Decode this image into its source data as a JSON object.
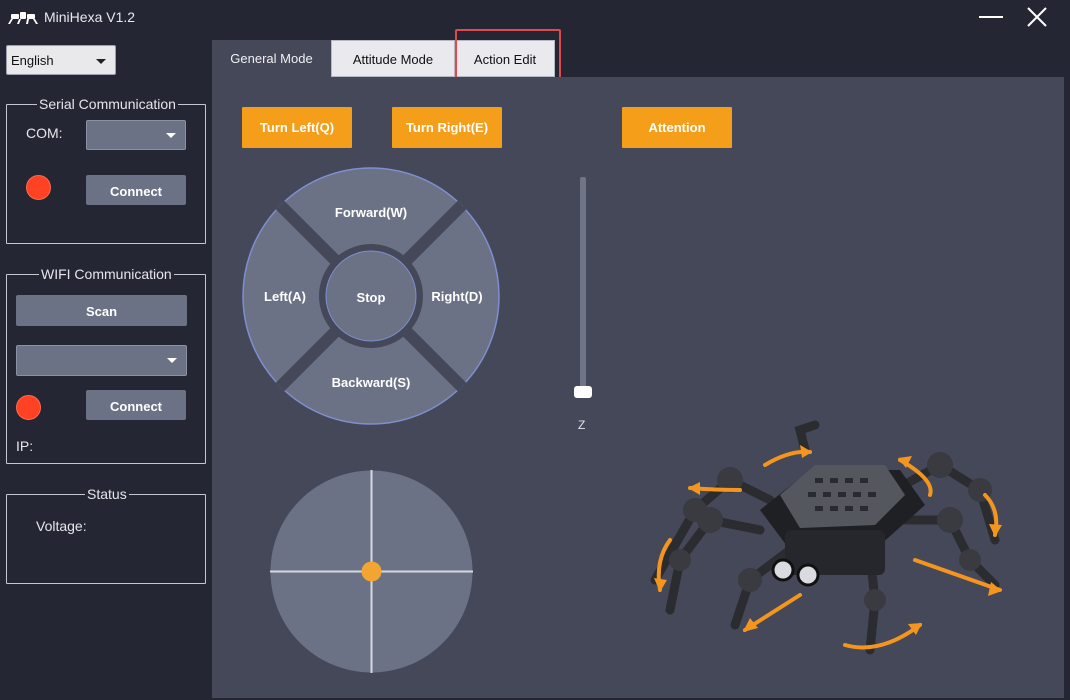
{
  "app": {
    "title": "MiniHexa V1.2",
    "logo_icon": "hexapod-logo-icon"
  },
  "language": {
    "selected": "English"
  },
  "serial": {
    "title": "Serial Communication",
    "com_label": "COM:",
    "com_value": "",
    "connect_label": "Connect",
    "status_color": "#ff4124"
  },
  "wifi": {
    "title": "WIFI Communication",
    "scan_label": "Scan",
    "network_value": "",
    "connect_label": "Connect",
    "ip_label": "IP:",
    "status_color": "#ff4124"
  },
  "status": {
    "title": "Status",
    "voltage_label": "Voltage:"
  },
  "tabs": [
    {
      "label": "General Mode",
      "active": true
    },
    {
      "label": "Attitude Mode",
      "active": false
    },
    {
      "label": "Action Edit",
      "active": false
    }
  ],
  "actions": {
    "turn_left": "Turn Left(Q)",
    "turn_right": "Turn Right(E)",
    "attention": "Attention"
  },
  "dpad": {
    "forward": "Forward(W)",
    "left": "Left(A)",
    "stop": "Stop",
    "right": "Right(D)",
    "backward": "Backward(S)"
  },
  "slider": {
    "label": "Z",
    "value": 0
  },
  "joystick": {
    "x": 0,
    "y": 0
  },
  "colors": {
    "accent": "#f49e1a",
    "background": "#242634",
    "panel": "#444858",
    "control": "#6b7285",
    "highlight": "#e04a4a"
  }
}
